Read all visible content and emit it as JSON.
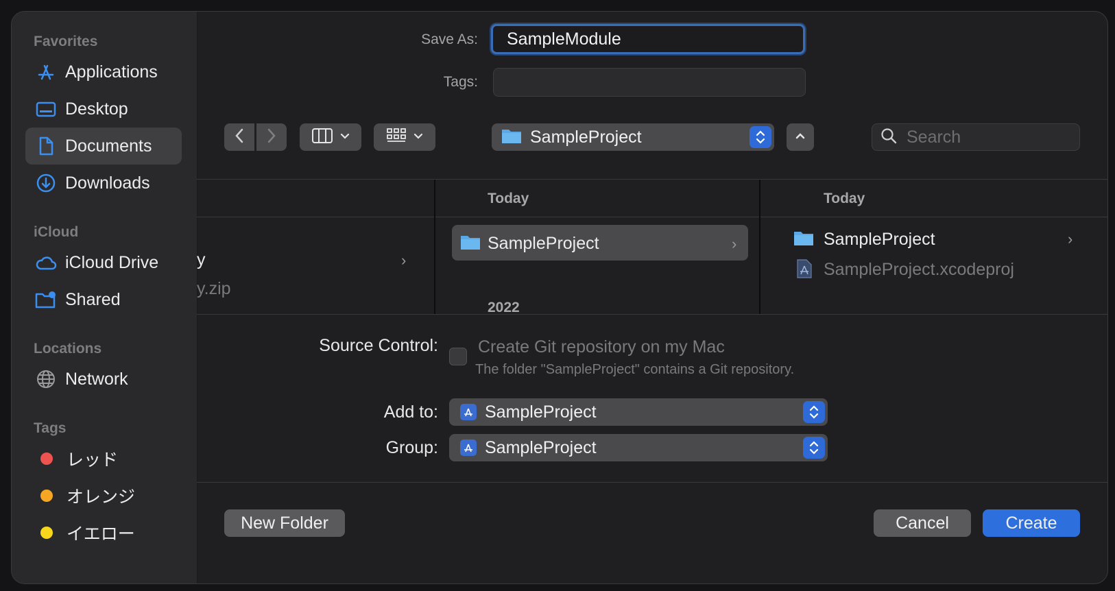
{
  "sidebar": {
    "favorites_heading": "Favorites",
    "favorites": [
      {
        "label": "Applications",
        "icon": "applications-icon"
      },
      {
        "label": "Desktop",
        "icon": "desktop-icon"
      },
      {
        "label": "Documents",
        "icon": "document-icon",
        "selected": true
      },
      {
        "label": "Downloads",
        "icon": "downloads-icon"
      }
    ],
    "icloud_heading": "iCloud",
    "icloud": [
      {
        "label": "iCloud Drive",
        "icon": "cloud-icon"
      },
      {
        "label": "Shared",
        "icon": "shared-folder-icon"
      }
    ],
    "locations_heading": "Locations",
    "locations": [
      {
        "label": "Network",
        "icon": "globe-icon"
      }
    ],
    "tags_heading": "Tags",
    "tags": [
      {
        "label": "レッド",
        "color": "#ef5350"
      },
      {
        "label": "オレンジ",
        "color": "#f5a623"
      },
      {
        "label": "イエロー",
        "color": "#f8d61c"
      }
    ]
  },
  "form": {
    "save_as_label": "Save As:",
    "save_as_value": "SampleModule",
    "tags_label": "Tags:",
    "tags_value": ""
  },
  "toolbar": {
    "location": "SampleProject",
    "search_placeholder": "Search"
  },
  "browser": {
    "col1": {
      "partial_name": "y",
      "partial_file": "y.zip"
    },
    "col2": {
      "header": "Today",
      "item": "SampleProject",
      "subheader": "2022"
    },
    "col3": {
      "header": "Today",
      "items": [
        "SampleProject",
        "SampleProject.xcodeproj"
      ]
    }
  },
  "bottom_form": {
    "source_control_label": "Source Control:",
    "git_checkbox_label": "Create Git repository on my Mac",
    "git_note": "The folder \"SampleProject\" contains a Git repository.",
    "add_to_label": "Add to:",
    "add_to_value": "SampleProject",
    "group_label": "Group:",
    "group_value": "SampleProject"
  },
  "buttons": {
    "new_folder": "New Folder",
    "cancel": "Cancel",
    "create": "Create"
  },
  "colors": {
    "accent": "#2e6fde",
    "folder": "#5aa9e6"
  }
}
